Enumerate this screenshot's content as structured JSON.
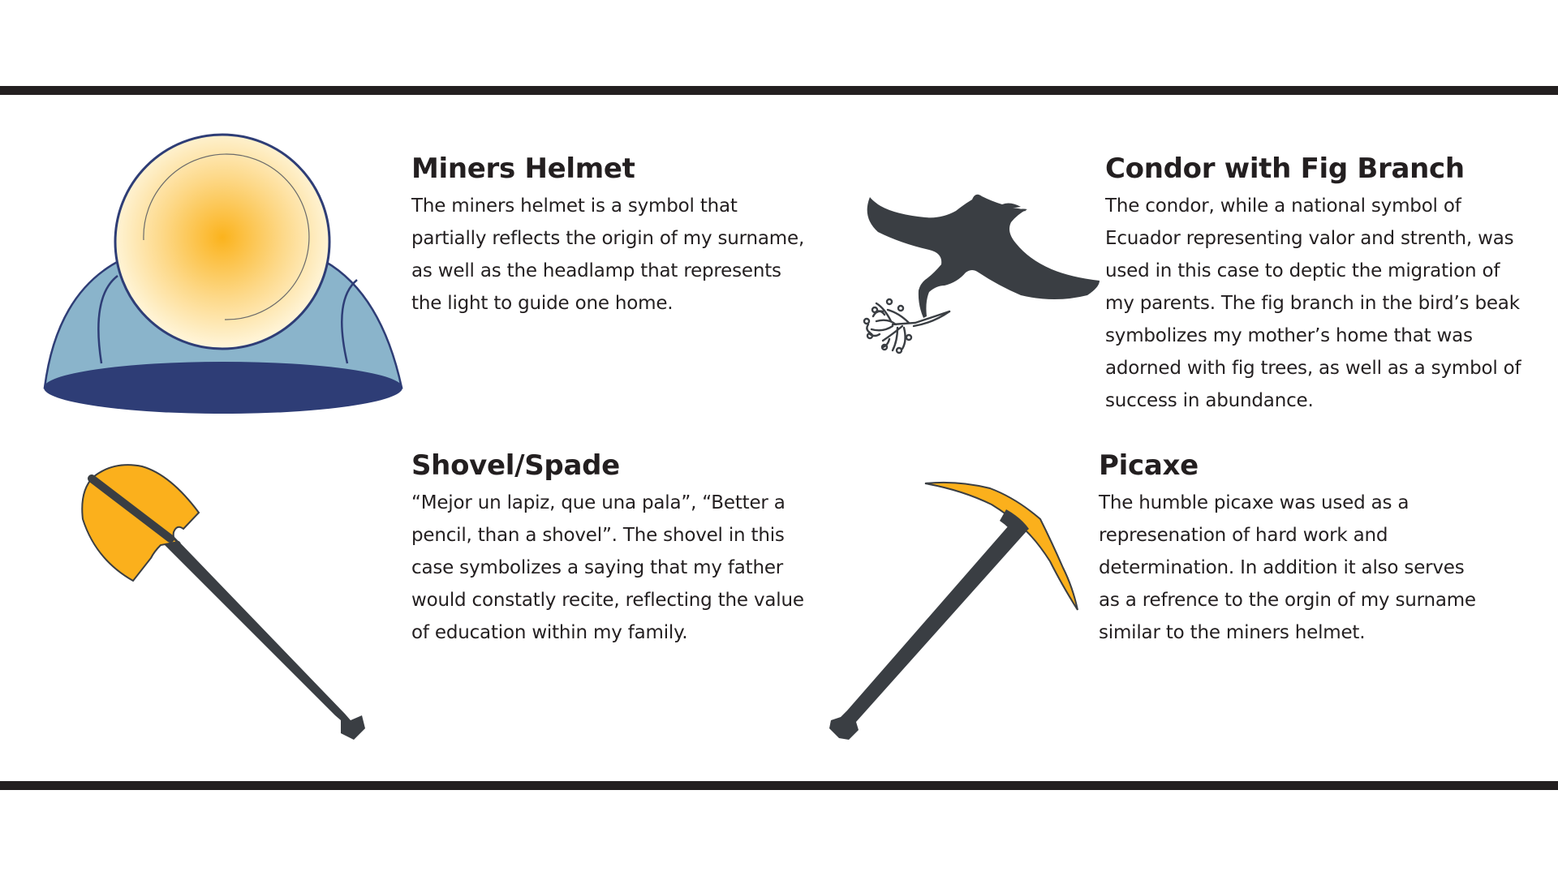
{
  "entries": {
    "helmet": {
      "title": "Miners Helmet",
      "description": "The miners helmet is a symbol that partially reflects the origin of my surname, as well as the headlamp that represents the light to guide one home."
    },
    "condor": {
      "title": "Condor with Fig Branch",
      "description": "The condor, while a national symbol of Ecuador representing valor and strenth, was used in this case to deptic the migration of my parents. The fig branch in the bird’s beak symbolizes my mother’s home that was adorned with fig trees, as well as a symbol of success in abundance."
    },
    "shovel": {
      "title": "Shovel/Spade",
      "description": "“Mejor un lapiz, que una pala”, “Better a pencil, than a shovel”. The shovel in this case symbolizes a saying that my father would constatly recite, reflecting the value of education within my family."
    },
    "picaxe": {
      "title": "Picaxe",
      "description": "The humble picaxe was used as a represenation of hard work and determination. In addition it also serves as a refrence to the orgin of my surname similar to the miners helmet."
    }
  },
  "colors": {
    "rule": "#231f20",
    "text": "#231f20",
    "helmet_shell": "#8ab4cb",
    "helmet_brim": "#2e3d76",
    "lamp_glow": "#fbb31d",
    "lamp_edge": "#fff4d6",
    "tool_handle": "#3a3e43",
    "tool_blade": "#fbb01c",
    "condor": "#3a3e43"
  },
  "icons": [
    "miners-helmet-icon",
    "condor-icon",
    "fig-branch-icon",
    "shovel-icon",
    "picaxe-icon"
  ]
}
